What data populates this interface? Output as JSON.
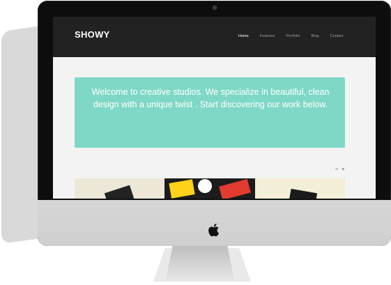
{
  "brand": "SHOWY",
  "nav": [
    "Home",
    "Features",
    "Portfolio",
    "Blog",
    "Contact"
  ],
  "hero_text": "Welcome to creative studios. We specialize in beautiful, clean design with a unique twist . Start discovering our work below.",
  "toolbar_icons": [
    "list-icon",
    "heart-icon"
  ],
  "colors": {
    "hero": "#7fd8c6",
    "nav": "#222222",
    "active_link": "#ffffff",
    "inactive_link": "#9b9b9b"
  }
}
